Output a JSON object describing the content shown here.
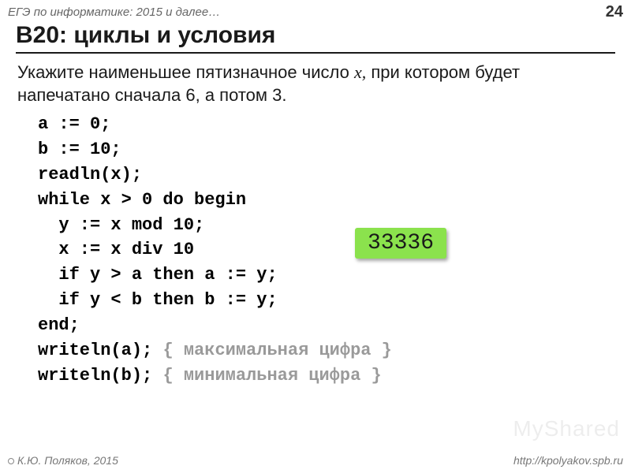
{
  "header": {
    "subject": "ЕГЭ по информатике: 2015 и далее…",
    "page": "24"
  },
  "title": "B20: циклы и условия",
  "prompt": {
    "part1": "Укажите наименьшее пятизначное число ",
    "xvar": "x,",
    "part2": " при котором будет напечатано сначала 6, а потом 3."
  },
  "code": {
    "l1": "a := 0;",
    "l2": "b := 10;",
    "l3": "readln(x);",
    "l4": "while x > 0 do begin",
    "l5": "  y := x mod 10;",
    "l6": "  x := x div 10",
    "l7": "  if y > a then a := y;",
    "l8": "  if y < b then b := y;",
    "l9": "end;",
    "l10a": "writeln(a); ",
    "l10b": "{ максимальная цифра }",
    "l11a": "writeln(b); ",
    "l11b": "{ минимальная цифра }"
  },
  "answer": "33336",
  "footer": {
    "author": "К.Ю. Поляков, 2015",
    "url": "http://kpolyakov.spb.ru"
  },
  "watermark": "MyShared"
}
